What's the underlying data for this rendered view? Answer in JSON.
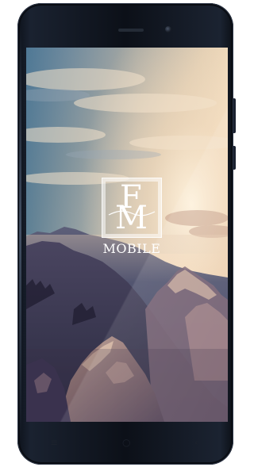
{
  "device": {
    "frame_color": "#0f141d",
    "screen": {
      "background": "mountain-sunrise-photo",
      "logo": {
        "letters_top": "F",
        "letters_bottom": "M",
        "brand_text": "MOBILE",
        "color": "#ffffff"
      }
    },
    "hardware": {
      "speaker": "earpiece-speaker",
      "camera": "front-camera"
    },
    "nav_buttons": [
      {
        "icon": "menu-icon"
      },
      {
        "icon": "home-icon"
      },
      {
        "icon": "back-icon"
      }
    ]
  }
}
